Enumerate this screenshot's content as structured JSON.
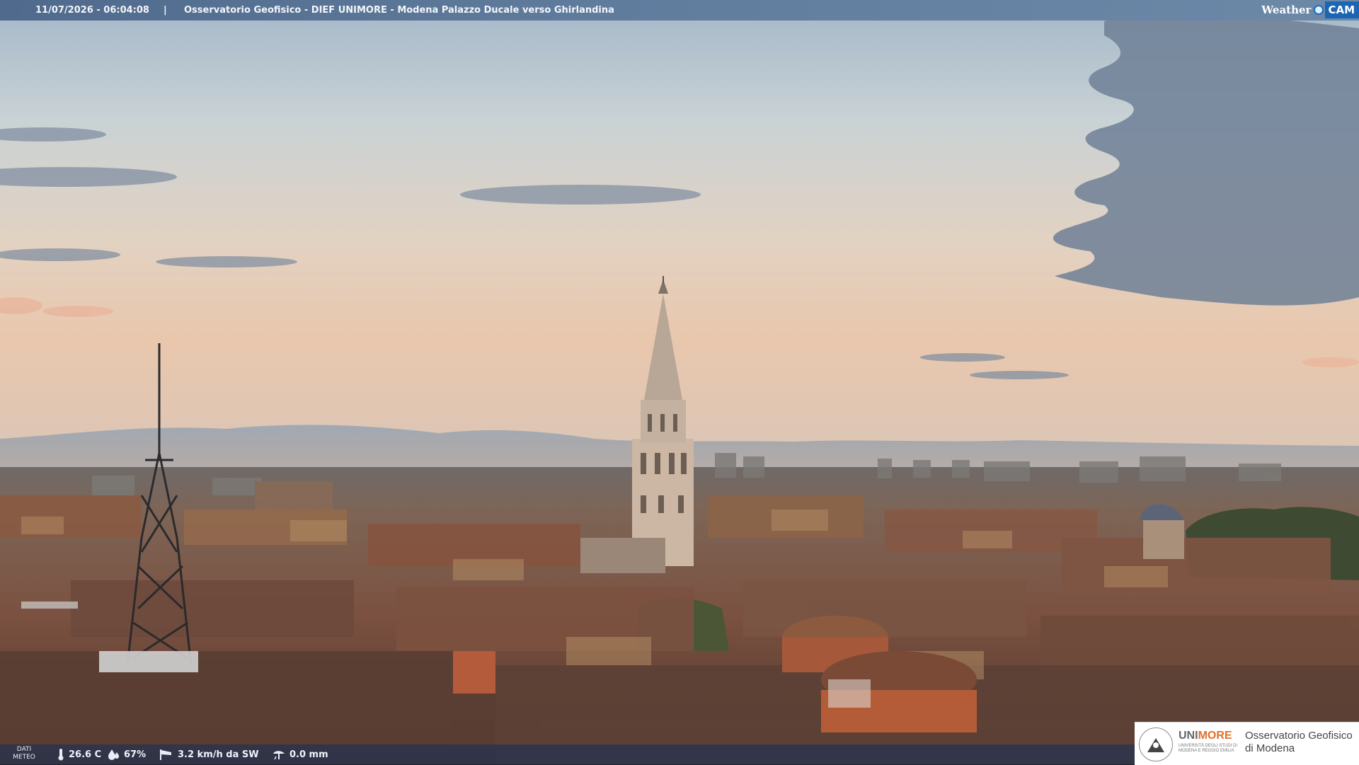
{
  "header": {
    "timestamp": "11/07/2026 - 06:04:08",
    "separator": "|",
    "title": "Osservatorio Geofisico - DIEF UNIMORE - Modena Palazzo Ducale verso Ghirlandina",
    "brand_weather": "Weather",
    "brand_cam": "CAM"
  },
  "weather": {
    "label_line1": "DATI",
    "label_line2": "METEO",
    "temperature": "26.6 C",
    "humidity": "67%",
    "wind": "3.2 km/h da SW",
    "rain": "0.0 mm",
    "icons": [
      "thermometer-icon",
      "humidity-drop-icon",
      "wind-sock-icon",
      "rain-gauge-icon"
    ]
  },
  "logo": {
    "uni": "UNI",
    "more": "MORE",
    "uni_sub_line1": "UNIVERSITÀ DEGLI STUDI DI",
    "uni_sub_line2": "MODENA E REGGIO EMILIA",
    "obs_line1": "Osservatorio Geofisico",
    "obs_line2": "di Modena"
  },
  "colors": {
    "sky_top": "#a9bccb",
    "sky_horizon": "#e8c7ad",
    "roofs": "#7a4e38",
    "brand_blue": "#1a66b5",
    "unimore_orange": "#e0702a"
  }
}
